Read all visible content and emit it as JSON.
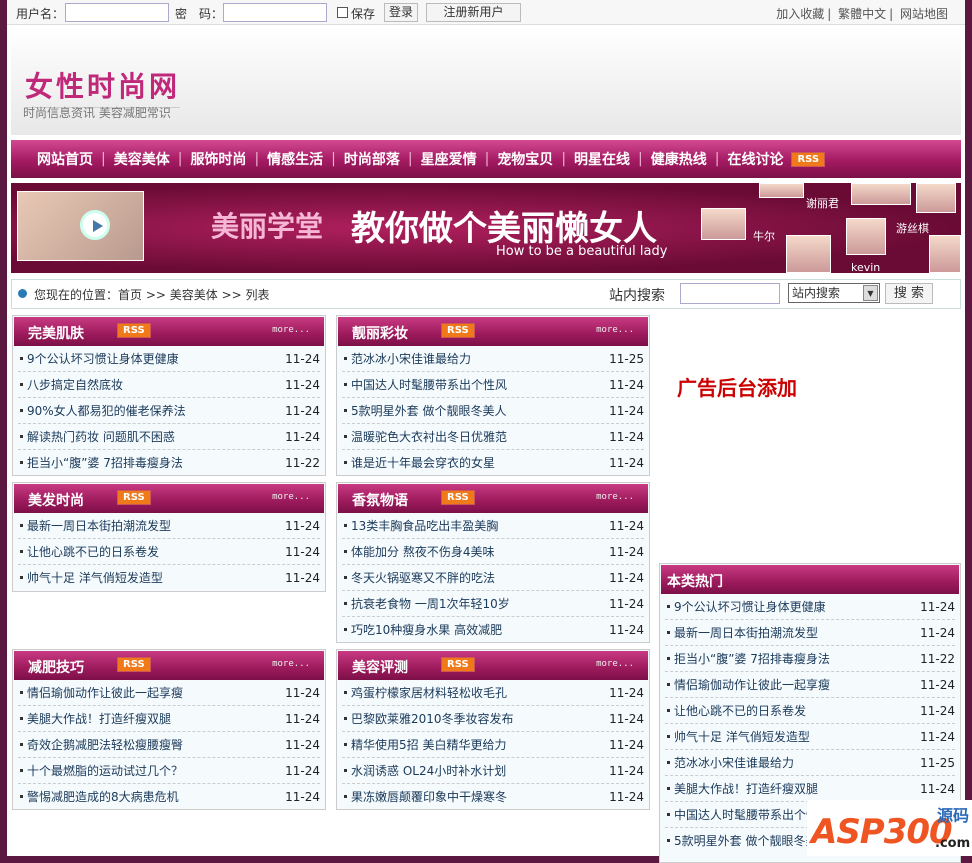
{
  "topbar": {
    "username_label": "用户名：",
    "password_label": "密　码：",
    "remember_label": "保存",
    "login": "登录",
    "register": "注册新用户",
    "links": [
      "加入收藏",
      "繁體中文",
      "网站地图"
    ]
  },
  "header": {
    "logo": "女性时尚网",
    "slogan": "时尚信息资讯 美容减肥常识"
  },
  "nav": {
    "items": [
      "网站首页",
      "美容美体",
      "服饰时尚",
      "情感生活",
      "时尚部落",
      "星座爱情",
      "宠物宝贝",
      "明星在线",
      "健康热线",
      "在线讨论"
    ],
    "rss": "RSS"
  },
  "banner": {
    "title1": "美丽学堂",
    "title2": "教你做个美丽懒女人",
    "subtitle": "How to be a beautiful lady",
    "names": [
      "谢丽君",
      "牛尔",
      "游丝棋",
      "kevin"
    ]
  },
  "breadcrumb": {
    "label": "您现在的位置：",
    "path": "首页 >> 美容美体 >> 列表"
  },
  "search": {
    "label": "站内搜索",
    "select": "站内搜索",
    "button": "搜 索"
  },
  "more": "more...",
  "boxes": [
    {
      "title": "完美肌肤",
      "items": [
        [
          "9个公认坏习惯让身体更健康",
          "11-24"
        ],
        [
          "八步搞定自然底妆",
          "11-24"
        ],
        [
          "90%女人都易犯的催老保养法",
          "11-24"
        ],
        [
          "解读热门药妆 问题肌不困惑",
          "11-24"
        ],
        [
          "拒当小“腹”婆 7招排毒瘦身法",
          "11-22"
        ]
      ]
    },
    {
      "title": "靓丽彩妆",
      "items": [
        [
          "范冰冰小宋佳谁最给力",
          "11-25"
        ],
        [
          "中国达人时髦腰带系出个性风",
          "11-24"
        ],
        [
          "5款明星外套 做个靓眼冬美人",
          "11-24"
        ],
        [
          "温暖驼色大衣衬出冬日优雅范",
          "11-24"
        ],
        [
          "谁是近十年最会穿衣的女星",
          "11-24"
        ]
      ]
    },
    {
      "title": "美发时尚",
      "items": [
        [
          "最新一周日本街拍潮流发型",
          "11-24"
        ],
        [
          "让他心跳不已的日系卷发",
          "11-24"
        ],
        [
          "帅气十足 洋气俏短发造型",
          "11-24"
        ]
      ]
    },
    {
      "title": "香氛物语",
      "items": [
        [
          "13类丰胸食品吃出丰盈美胸",
          "11-24"
        ],
        [
          "体能加分 熬夜不伤身4美味",
          "11-24"
        ],
        [
          "冬天火锅驱寒又不胖的吃法",
          "11-24"
        ],
        [
          "抗衰老食物 一周1次年轻10岁",
          "11-24"
        ],
        [
          "巧吃10种瘦身水果 高效减肥",
          "11-24"
        ]
      ]
    },
    {
      "title": "减肥技巧",
      "items": [
        [
          "情侣瑜伽动作让彼此一起享瘦",
          "11-24"
        ],
        [
          "美腿大作战！打造纤瘦双腿",
          "11-24"
        ],
        [
          "奇效企鹅减肥法轻松瘦腰瘦臀",
          "11-24"
        ],
        [
          "十个最燃脂的运动试过几个？",
          "11-24"
        ],
        [
          "警惕减肥造成的8大病患危机",
          "11-24"
        ]
      ]
    },
    {
      "title": "美容评测",
      "items": [
        [
          "鸡蛋柠檬家居材料轻松收毛孔",
          "11-24"
        ],
        [
          "巴黎欧莱雅2010冬季妆容发布",
          "11-24"
        ],
        [
          "精华使用5招 美白精华更给力",
          "11-24"
        ],
        [
          "水润诱惑 OL24小时补水计划",
          "11-24"
        ],
        [
          "果冻嫩唇颠覆印象中干燥寒冬",
          "11-24"
        ]
      ]
    }
  ],
  "ad": "广告后台添加",
  "hot": {
    "title": "本类热门",
    "items": [
      [
        "9个公认坏习惯让身体更健康",
        "11-24"
      ],
      [
        "最新一周日本街拍潮流发型",
        "11-24"
      ],
      [
        "拒当小“腹”婆 7招排毒瘦身法",
        "11-22"
      ],
      [
        "情侣瑜伽动作让彼此一起享瘦",
        "11-24"
      ],
      [
        "让他心跳不已的日系卷发",
        "11-24"
      ],
      [
        "帅气十足 洋气俏短发造型",
        "11-24"
      ],
      [
        "范冰冰小宋佳谁最给力",
        "11-25"
      ],
      [
        "美腿大作战！打造纤瘦双腿",
        "11-24"
      ],
      [
        "中国达人时髦腰带系出个性风",
        ""
      ],
      [
        "5款明星外套 做个靓眼冬美人",
        ""
      ]
    ]
  },
  "watermark": {
    "logo": "ASP300",
    "cn": "源码",
    "domain": ".com"
  },
  "colors": {
    "accent": "#a41a62",
    "frame": "#5b1840",
    "rss": "#f07a1a",
    "ad": "#cc0000"
  }
}
